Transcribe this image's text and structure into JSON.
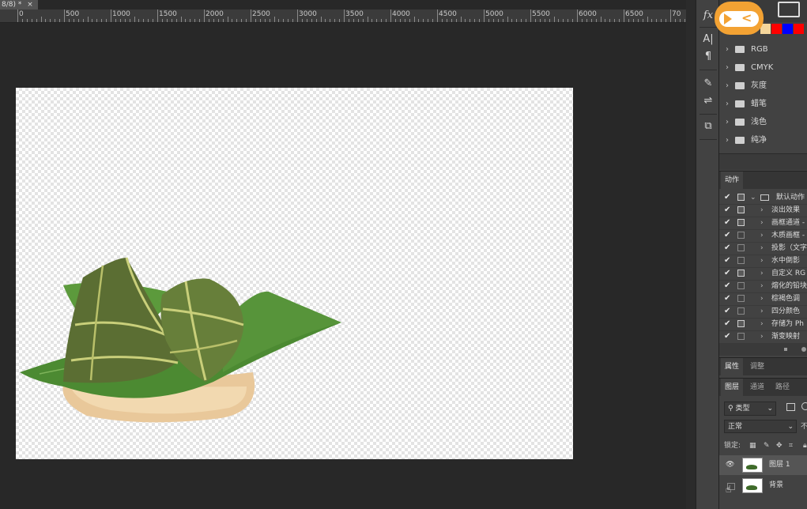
{
  "document": {
    "tab_title": "8/8) *",
    "close_glyph": "×"
  },
  "ruler": {
    "ticks": [
      "0",
      "500",
      "1000",
      "1500",
      "2000",
      "2500",
      "3000",
      "3500",
      "4000",
      "4500",
      "5000",
      "5500",
      "6000",
      "6500",
      "70"
    ]
  },
  "tools": [
    {
      "name": "fx-icon",
      "glyph": "fx"
    },
    {
      "name": "character-panel-icon",
      "glyph": "A|"
    },
    {
      "name": "paragraph-panel-icon",
      "glyph": "¶"
    },
    {
      "name": "brush-settings-icon",
      "glyph": "✎"
    },
    {
      "name": "adjustments-icon",
      "glyph": "⇌"
    },
    {
      "name": "clone-source-icon",
      "glyph": "⧉"
    }
  ],
  "swatches": [
    "#f5d69b",
    "#ff0000",
    "#0000ff",
    "#ff0000"
  ],
  "styles_folders": [
    {
      "label": "RGB"
    },
    {
      "label": "CMYK"
    },
    {
      "label": "灰度"
    },
    {
      "label": "蜡笔"
    },
    {
      "label": "浅色"
    },
    {
      "label": "纯净"
    }
  ],
  "actions_panel": {
    "tab": "动作",
    "set_name": "默认动作",
    "items": [
      {
        "label": "淡出效果",
        "dialog": true
      },
      {
        "label": "画框通道 -",
        "dialog": true
      },
      {
        "label": "木质画框 -",
        "dialog": false
      },
      {
        "label": "投影（文字",
        "dialog": false
      },
      {
        "label": "水中倒影",
        "dialog": false
      },
      {
        "label": "自定义 RG",
        "dialog": true
      },
      {
        "label": "熔化的铅块",
        "dialog": false
      },
      {
        "label": "棕褐色调",
        "dialog": false
      },
      {
        "label": "四分颜色",
        "dialog": false
      },
      {
        "label": "存储为 Ph",
        "dialog": true
      },
      {
        "label": "渐变映射",
        "dialog": false
      }
    ]
  },
  "properties_tabs": [
    "属性",
    "调整"
  ],
  "layers_tabs": [
    "图层",
    "通道",
    "路径"
  ],
  "layers_panel": {
    "filter_type": "类型",
    "blend_mode": "正常",
    "opacity_label": "不",
    "lock_label": "锁定:",
    "layers": [
      {
        "name": "图层 1",
        "visible": true,
        "selected": true
      },
      {
        "name": "背景",
        "visible": false,
        "selected": false
      }
    ]
  }
}
